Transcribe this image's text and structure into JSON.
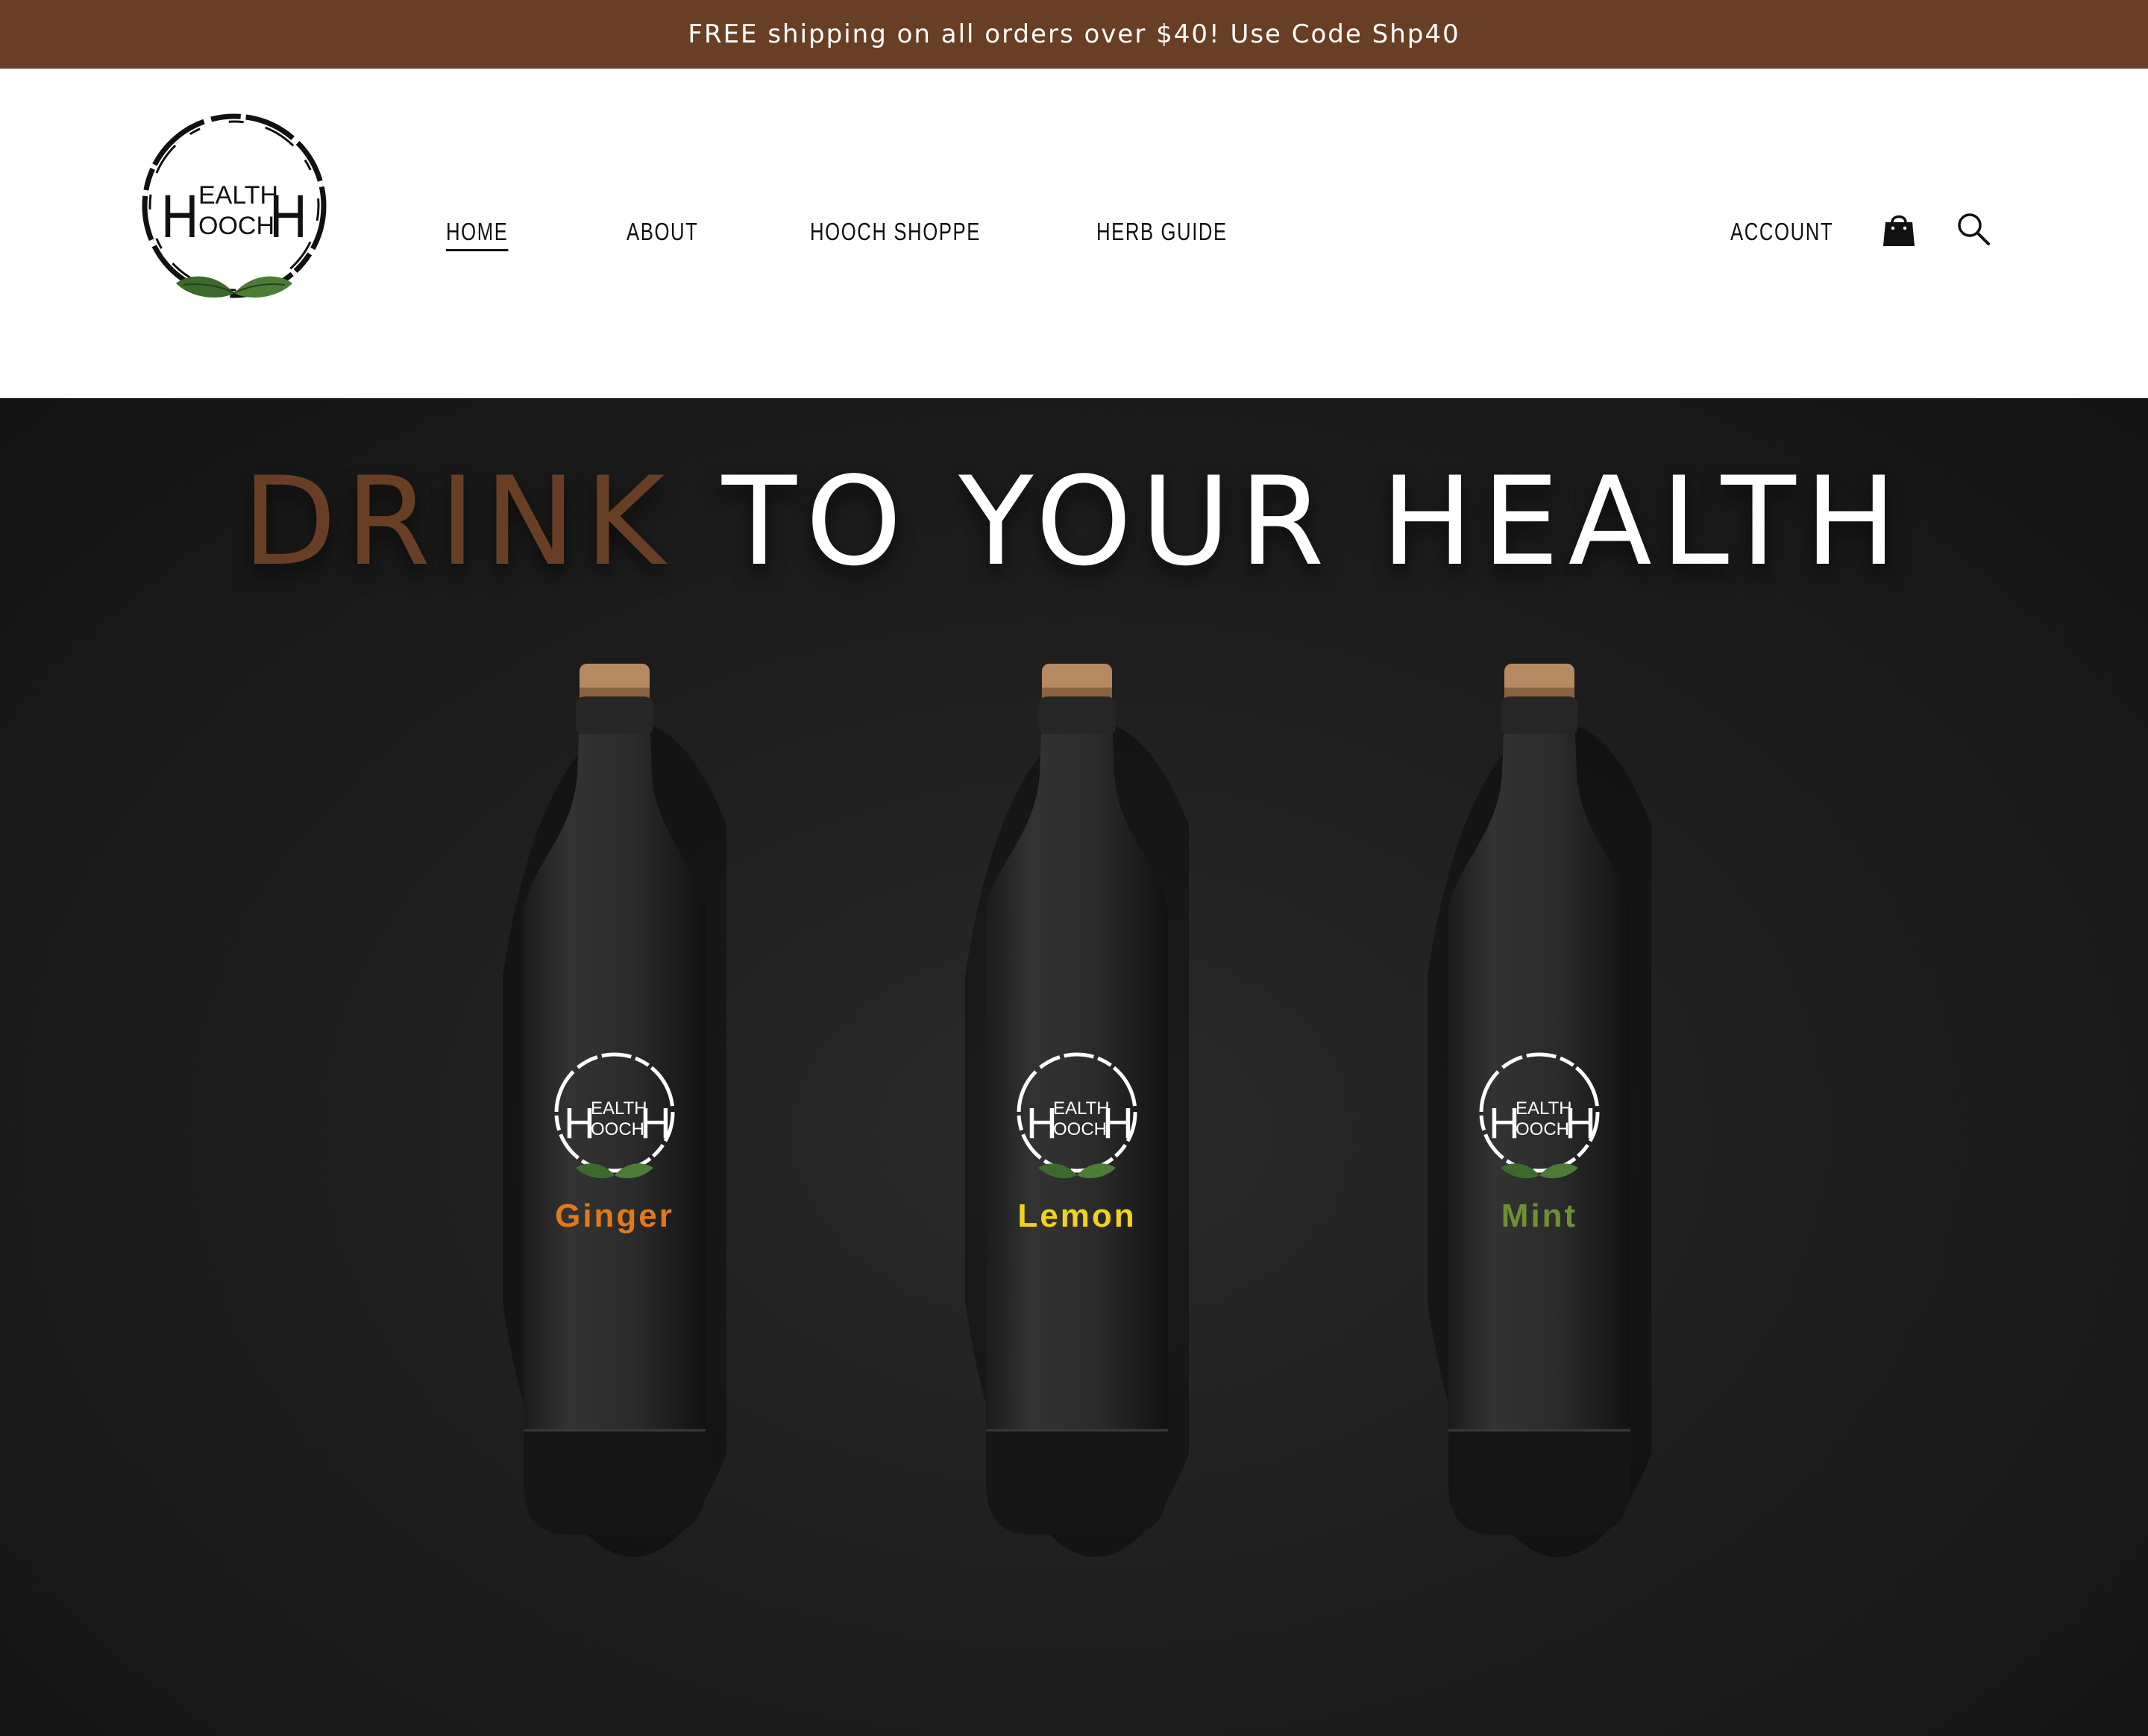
{
  "announcement": {
    "text": "FREE shipping on all orders over $40! Use Code Shp40"
  },
  "brand": {
    "logo_lines": [
      "EALTH",
      "OOCH"
    ],
    "logo_letter": "H",
    "logo_color": "#111111",
    "leaf_color": "#3c6a2c"
  },
  "nav": {
    "items": [
      {
        "label": "HOME",
        "active": true
      },
      {
        "label": "ABOUT",
        "active": false
      },
      {
        "label": "HOOCH SHOPPE",
        "active": false
      },
      {
        "label": "HERB GUIDE",
        "active": false
      }
    ],
    "account_label": "ACCOUNT",
    "cart_icon": "shopping-bag-icon",
    "search_icon": "search-icon"
  },
  "hero": {
    "title_accent": "DRINK",
    "title_rest": "TO YOUR HEALTH",
    "accent_color": "#683f24",
    "bottles": [
      {
        "flavor": "Ginger",
        "color": "#e07a1c"
      },
      {
        "flavor": "Lemon",
        "color": "#f2d21c"
      },
      {
        "flavor": "Mint",
        "color": "#6e8f34"
      }
    ]
  },
  "colors": {
    "announcement_bg": "#683f24",
    "hero_bg": "#1c1c1c"
  }
}
